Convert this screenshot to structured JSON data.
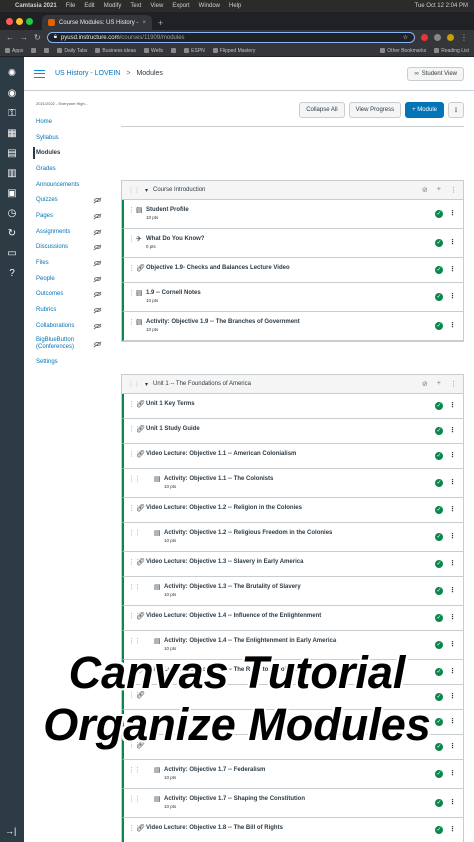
{
  "mac_menu": [
    "Camtasia 2021",
    "File",
    "Edit",
    "Modify",
    "Text",
    "View",
    "Export",
    "Window",
    "Help"
  ],
  "mac_clock": "Tue Oct 12  2:04 PM",
  "browser": {
    "tab_title": "Course Modules: US History -",
    "url_host": "pyusd.instructure.com",
    "url_path": "/courses/11909/modules",
    "bookmarks": [
      "Apps",
      "Daily Tabs",
      "Business ideas",
      "Wells",
      "ESPN",
      "Flipped Mastery"
    ],
    "bookmarks_right": [
      "Other Bookmarks",
      "Reading List"
    ]
  },
  "header": {
    "course": "US History - LOVEIN",
    "separator": ">",
    "page": "Modules",
    "student_view": "Student View"
  },
  "course_nav": {
    "term": "2021/2022 - Everyone High...",
    "items": [
      {
        "label": "Home",
        "hidden": false
      },
      {
        "label": "Syllabus",
        "hidden": false
      },
      {
        "label": "Modules",
        "hidden": false,
        "active": true
      },
      {
        "label": "Grades",
        "hidden": false
      },
      {
        "label": "Announcements",
        "hidden": false
      },
      {
        "label": "Quizzes",
        "hidden": true
      },
      {
        "label": "Pages",
        "hidden": true
      },
      {
        "label": "Assignments",
        "hidden": true
      },
      {
        "label": "Discussions",
        "hidden": true
      },
      {
        "label": "Files",
        "hidden": true
      },
      {
        "label": "People",
        "hidden": true
      },
      {
        "label": "Outcomes",
        "hidden": true
      },
      {
        "label": "Rubrics",
        "hidden": true
      },
      {
        "label": "Collaborations",
        "hidden": true
      },
      {
        "label": "BigBlueButton (Conferences)",
        "hidden": true
      },
      {
        "label": "Settings",
        "hidden": false
      }
    ]
  },
  "actions": {
    "collapse_all": "Collapse All",
    "view_progress": "View Progress",
    "add_module": "+ Module"
  },
  "modules": [
    {
      "title": "Course Introduction",
      "items": [
        {
          "type": "assignment",
          "title": "Student Profile",
          "points": "10 pts",
          "indent": false
        },
        {
          "type": "quiz",
          "title": "What Do You Know?",
          "points": "0 pts",
          "indent": false
        },
        {
          "type": "link",
          "title": "Objective 1.9- Checks and Balances Lecture Video",
          "points": "",
          "indent": false
        },
        {
          "type": "assignment",
          "title": "1.9 -- Cornell Notes",
          "points": "10 pts",
          "indent": false
        },
        {
          "type": "assignment",
          "title": "Activity: Objective 1.9 -- The Branches of Government",
          "points": "10 pts",
          "indent": false
        }
      ]
    },
    {
      "title": "Unit 1 -- The Foundations of America",
      "items": [
        {
          "type": "link",
          "title": "Unit 1 Key Terms",
          "points": "",
          "indent": false
        },
        {
          "type": "link",
          "title": "Unit 1 Study Guide",
          "points": "",
          "indent": false
        },
        {
          "type": "link",
          "title": "Video Lecture: Objective 1.1 -- American Colonialism",
          "points": "",
          "indent": false
        },
        {
          "type": "assignment",
          "title": "Activity: Objective 1.1 -- The Colonists",
          "points": "10 pts",
          "indent": true
        },
        {
          "type": "link",
          "title": "Video Lecture: Objective 1.2 -- Religion in the Colonies",
          "points": "",
          "indent": false
        },
        {
          "type": "assignment",
          "title": "Activity: Objective 1.2 -- Religious Freedom in the Colonies",
          "points": "10 pts",
          "indent": true
        },
        {
          "type": "link",
          "title": "Video Lecture: Objective 1.3 -- Slavery in Early America",
          "points": "",
          "indent": false
        },
        {
          "type": "assignment",
          "title": "Activity: Objective 1.3 -- The Brutality of Slavery",
          "points": "10 pts",
          "indent": true
        },
        {
          "type": "link",
          "title": "Video Lecture: Objective 1.4 -- Influence of the Enlightenment",
          "points": "",
          "indent": false
        },
        {
          "type": "assignment",
          "title": "Activity: Objective 1.4 -- The Enlightenment in Early America",
          "points": "10 pts",
          "indent": true
        },
        {
          "type": "link",
          "title": "Video Lecture: Objective 1.5 -- The Road to Revolution",
          "points": "",
          "indent": false
        },
        {
          "type": "link",
          "title": "",
          "points": "",
          "indent": false
        },
        {
          "type": "link",
          "title": "",
          "points": "",
          "indent": false
        },
        {
          "type": "link",
          "title": "",
          "points": "",
          "indent": false
        },
        {
          "type": "assignment",
          "title": "Activity: Objective 1.7 -- Federalism",
          "points": "10 pts",
          "indent": true
        },
        {
          "type": "assignment",
          "title": "Activity: Objective 1.7 -- Shaping the Constitution",
          "points": "10 pts",
          "indent": true
        },
        {
          "type": "link",
          "title": "Video Lecture: Objective 1.8 -- The Bill of Rights",
          "points": "",
          "indent": false
        }
      ]
    }
  ],
  "overlay": {
    "line1": "Canvas Tutorial",
    "line2": "Organize Modules"
  },
  "colors": {
    "brand": "#0374b5",
    "published": "#0b874b",
    "nav": "#2d3b45"
  }
}
